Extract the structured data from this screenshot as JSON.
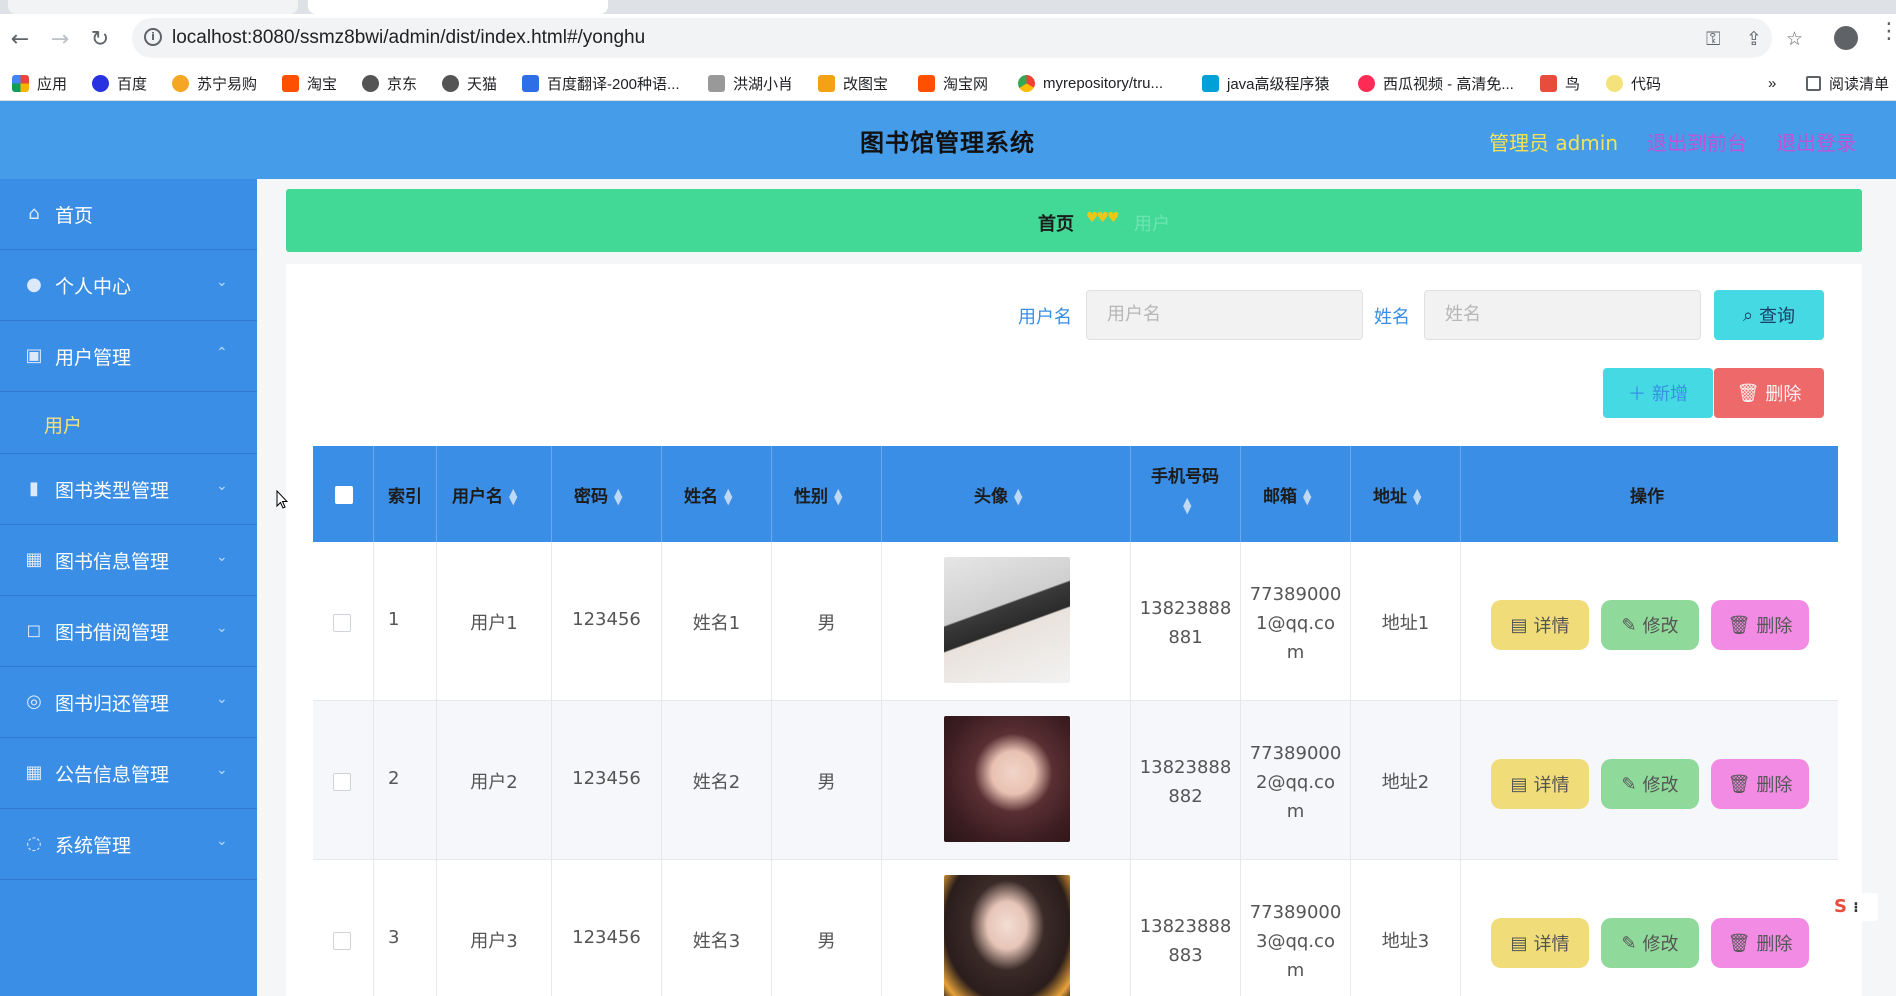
{
  "browser": {
    "url": "localhost:8080/ssmz8bwi/admin/dist/index.html#/yonghu",
    "bookmarks": [
      {
        "label": "应用",
        "color": "#e8453c"
      },
      {
        "label": "百度",
        "color": "#2932e1"
      },
      {
        "label": "苏宁易购",
        "color": "#f5a623"
      },
      {
        "label": "淘宝",
        "color": "#ff5000"
      },
      {
        "label": "京东",
        "color": "#555555"
      },
      {
        "label": "天猫",
        "color": "#555555"
      },
      {
        "label": "百度翻译-200种语...",
        "color": "#2f6ee7"
      },
      {
        "label": "洪湖小肖",
        "color": "#777777"
      },
      {
        "label": "改图宝",
        "color": "#f2a213"
      },
      {
        "label": "淘宝网",
        "color": "#ff5000"
      },
      {
        "label": "myrepository/tru...",
        "color": "#34a853"
      },
      {
        "label": "java高级程序猿",
        "color": "#00a1d6"
      },
      {
        "label": "西瓜视频 - 高清免...",
        "color": "#fe2c55"
      },
      {
        "label": "鸟",
        "color": "#e74c3c"
      },
      {
        "label": "代码",
        "color": "#f4e27a"
      }
    ],
    "more": "»",
    "reading_list": "阅读清单"
  },
  "header": {
    "title": "图书馆管理系统",
    "admin_label": "管理员 admin",
    "to_front": "退出到前台",
    "logout": "退出登录"
  },
  "sidebar": {
    "items": [
      {
        "label": "首页",
        "icon": "⌂"
      },
      {
        "label": "个人中心",
        "icon": "●"
      },
      {
        "label": "用户管理",
        "icon": "▣"
      },
      {
        "label": "图书类型管理",
        "icon": "▮"
      },
      {
        "label": "图书信息管理",
        "icon": "▦"
      },
      {
        "label": "图书借阅管理",
        "icon": "◻"
      },
      {
        "label": "图书归还管理",
        "icon": "◎"
      },
      {
        "label": "公告信息管理",
        "icon": "▦"
      },
      {
        "label": "系统管理",
        "icon": "◌"
      }
    ],
    "subitem": "用户"
  },
  "breadcrumb": {
    "home": "首页",
    "separator": "♥♥♥",
    "current": "用户"
  },
  "search": {
    "username_label": "用户名",
    "username_placeholder": "用户名",
    "name_label": "姓名",
    "name_placeholder": "姓名",
    "query": "查询"
  },
  "toolbar": {
    "add": "新增",
    "delete": "删除"
  },
  "table": {
    "headers": {
      "index": "索引",
      "username": "用户名",
      "password": "密码",
      "name": "姓名",
      "gender": "性别",
      "avatar": "头像",
      "phone": "手机号码",
      "email": "邮箱",
      "address": "地址",
      "actions": "操作"
    },
    "rows": [
      {
        "index": "1",
        "username": "用户1",
        "password": "123456",
        "name": "姓名1",
        "gender": "男",
        "phone_l1": "13823888",
        "phone_l2": "881",
        "email_l1": "77389000",
        "email_l2": "1@qq.co",
        "email_l3": "m",
        "address": "地址1"
      },
      {
        "index": "2",
        "username": "用户2",
        "password": "123456",
        "name": "姓名2",
        "gender": "男",
        "phone_l1": "13823888",
        "phone_l2": "882",
        "email_l1": "77389000",
        "email_l2": "2@qq.co",
        "email_l3": "m",
        "address": "地址2"
      },
      {
        "index": "3",
        "username": "用户3",
        "password": "123456",
        "name": "姓名3",
        "gender": "男",
        "phone_l1": "13823888",
        "phone_l2": "883",
        "email_l1": "77389000",
        "email_l2": "3@qq.co",
        "email_l3": "m",
        "address": "地址3"
      }
    ],
    "actions": {
      "detail": "详情",
      "edit": "修改",
      "delete": "删除"
    }
  },
  "colors": {
    "header_bg": "#459ce9",
    "sidebar_bg": "#3a8ee6",
    "breadcrumb_bg": "#41d995",
    "query_btn": "#45d9e3",
    "add_btn": "#45d9e3",
    "delete_btn": "#ee6969",
    "detail_btn": "#f0dc78",
    "edit_btn": "#8fd99a",
    "row_delete_btn": "#f18be3",
    "admin_text": "#f5e257",
    "header_link": "#c052d6"
  }
}
